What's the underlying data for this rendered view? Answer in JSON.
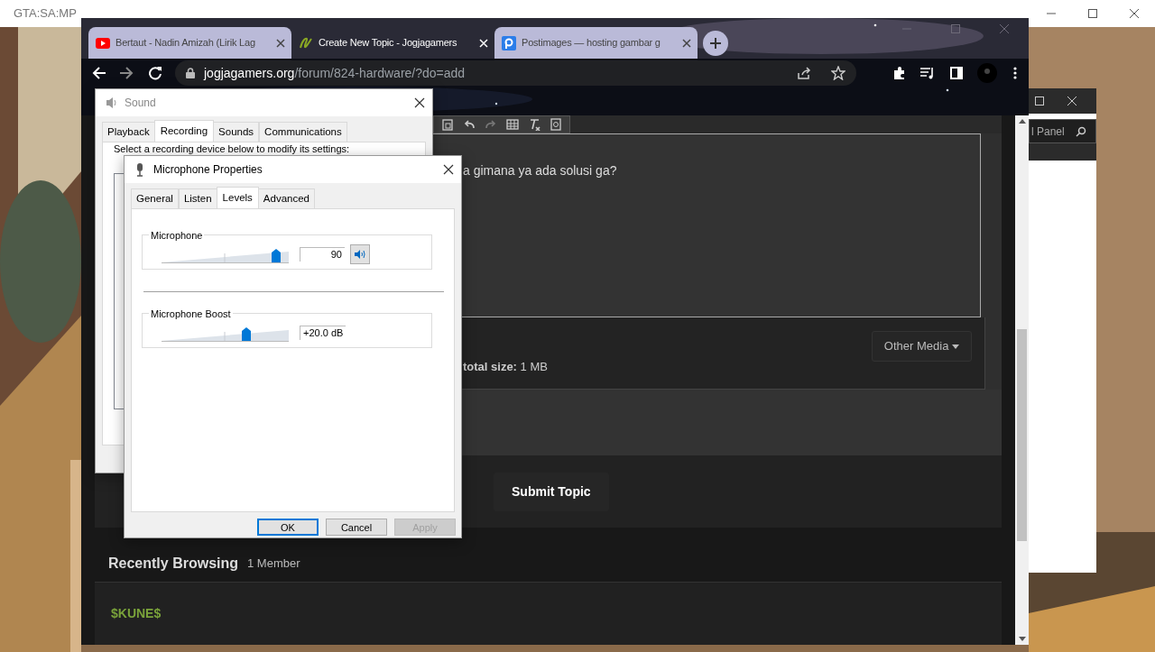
{
  "game_window": {
    "title": "GTA:SA:MP"
  },
  "control_panel": {
    "search": {
      "placeholder": "l Panel"
    }
  },
  "browser": {
    "tabs": [
      {
        "kind": "video",
        "title": "Bertaut - Nadin Amizah (Lirik Lag",
        "selected": false
      },
      {
        "kind": "forum",
        "title": "Create New Topic - Jogjagamers",
        "selected": true
      },
      {
        "kind": "image-host",
        "title": "Postimages — hosting gambar g",
        "selected": false
      }
    ],
    "address": {
      "domain": "jogjagamers.org",
      "path": "/forum/824-hardware/?do=add"
    },
    "page": {
      "editor_text": "a gimana ya ada solusi ga?",
      "other_media": "Other Media",
      "attachment_info": "**total size:** 1 MB",
      "submit": "Submit Topic",
      "recently_browsing": {
        "title": "Recently Browsing",
        "count": "1 Member"
      },
      "members": [
        {
          "name": "$KUNE$"
        }
      ]
    }
  },
  "sound_dialog": {
    "title": "Sound",
    "tabs": [
      {
        "label": "Playback",
        "selected": false
      },
      {
        "label": "Recording",
        "selected": true
      },
      {
        "label": "Sounds",
        "selected": false
      },
      {
        "label": "Communications",
        "selected": false
      }
    ],
    "instruction": "Select a recording device below to modify its settings:"
  },
  "mic_dialog": {
    "title": "Microphone Properties",
    "tabs": [
      {
        "label": "General",
        "selected": false
      },
      {
        "label": "Listen",
        "selected": false
      },
      {
        "label": "Levels",
        "selected": true
      },
      {
        "label": "Advanced",
        "selected": false
      }
    ],
    "groups": [
      {
        "kind": "volume",
        "label": "Microphone",
        "level": 0.9,
        "value": "90",
        "muted": false
      },
      {
        "kind": "boost",
        "label": "Microphone Boost",
        "level": 0.667,
        "value": "+20.0 dB"
      }
    ],
    "buttons": [
      {
        "label": "OK",
        "default": true,
        "disabled": false
      },
      {
        "label": "Cancel",
        "default": false,
        "disabled": false
      },
      {
        "label": "Apply",
        "default": false,
        "disabled": true
      }
    ]
  }
}
